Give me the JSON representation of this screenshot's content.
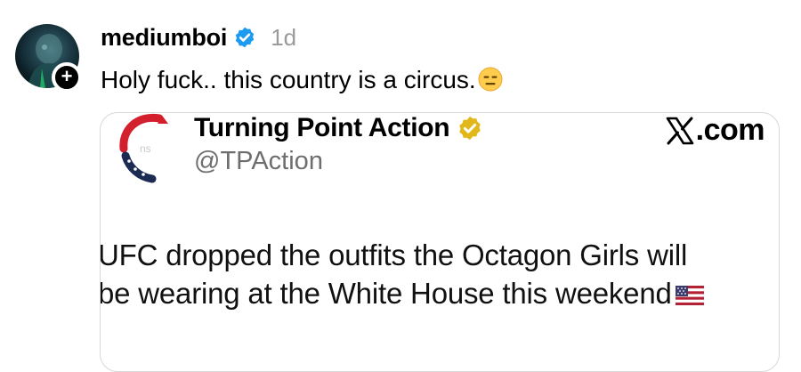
{
  "post": {
    "username": "mediumboi",
    "verified_icon": "blue-verified-badge",
    "timestamp": "1d",
    "text": "Holy fuck.. this country is a circus.",
    "text_emoji": "expressionless-face",
    "follow_icon": "plus-icon"
  },
  "embed": {
    "account_name": "Turning Point Action",
    "account_verified_icon": "gold-verified-badge",
    "handle": "@TPAction",
    "source_label": ".com",
    "source_icon": "x-logo",
    "body_line_1": "UFC dropped the outfits the Octagon Girls will",
    "body_line_2": "be wearing at the White House this weekend",
    "body_emoji": "us-flag"
  },
  "colors": {
    "verified_blue": "#1d9bf0",
    "gold_badge": "#e2b719",
    "timestamp_gray": "#9a9a9a",
    "handle_gray": "#6e6e6e",
    "tp_red": "#d41f2d",
    "tp_navy": "#1c2b52",
    "card_border": "#d8d8d8"
  }
}
